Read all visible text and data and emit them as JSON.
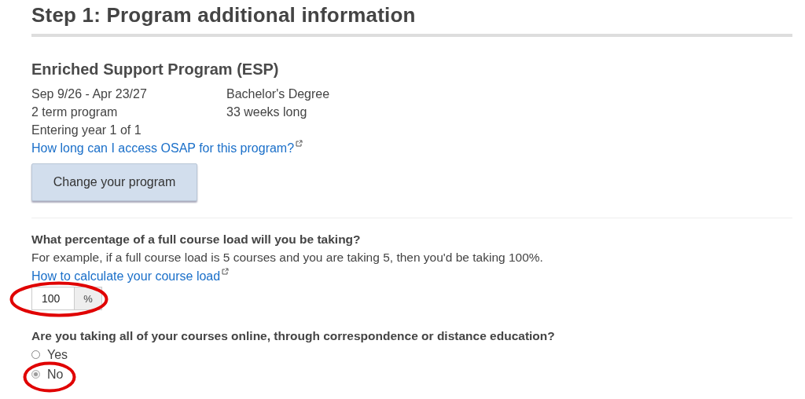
{
  "heading": "Step 1: Program additional information",
  "program": {
    "name": "Enriched Support Program (ESP)",
    "details_left": [
      "Sep 9/26 - Apr 23/27",
      "2 term program",
      "Entering year 1 of 1"
    ],
    "details_right": [
      "Bachelor's Degree",
      "33 weeks long"
    ],
    "link": "How long can I access OSAP for this program?",
    "button": "Change your program"
  },
  "course_load": {
    "question": "What percentage of a full course load will you be taking?",
    "hint": "For example, if a full course load is 5 courses and you are taking 5, then you'd be taking 100%.",
    "link": "How to calculate your course load",
    "value": "100",
    "unit": "%",
    "circled": true
  },
  "online": {
    "question": "Are you taking all of your courses online, through correspondence or distance education?",
    "options": [
      {
        "label": "Yes",
        "selected": false,
        "circled": false
      },
      {
        "label": "No",
        "selected": true,
        "circled": true
      }
    ]
  }
}
